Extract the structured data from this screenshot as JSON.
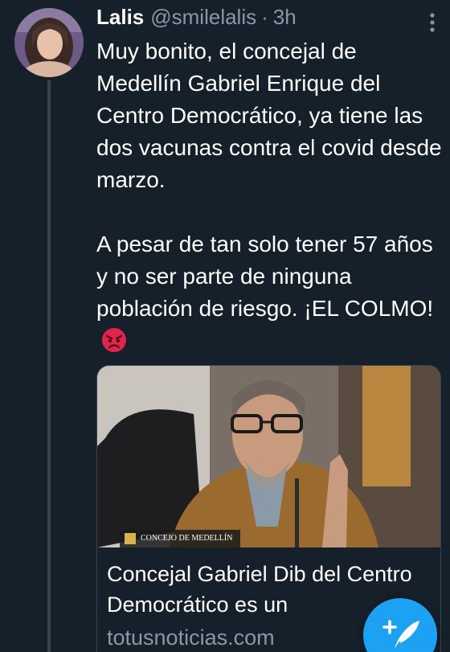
{
  "tweet": {
    "display_name": "Lalis",
    "handle": "@smilelalis",
    "separator": "·",
    "time": "3h",
    "text_paragraph_1": "Muy bonito, el concejal de Medellín Gabriel Enrique del Centro Democrático, ya tiene las dos vacunas contra el covid desde marzo.",
    "text_paragraph_2": "A pesar de tan solo tener 57 años y no ser parte de ninguna población de riesgo. ¡EL COLMO!",
    "emoji": "angry-face-icon"
  },
  "link_card": {
    "image_caption": "CONCEJO DE MEDELLÍN",
    "title": "Concejal Gabriel Dib del Centro Democrático es un",
    "domain": "totusnoticias.com"
  },
  "icons": {
    "more": "more-vertical-icon",
    "compose": "compose-tweet-icon"
  },
  "colors": {
    "background": "#15202b",
    "text_primary": "#ffffff",
    "text_secondary": "#8899a6",
    "border": "#38444d",
    "accent": "#1da1f2",
    "emoji_red": "#e0254a"
  }
}
